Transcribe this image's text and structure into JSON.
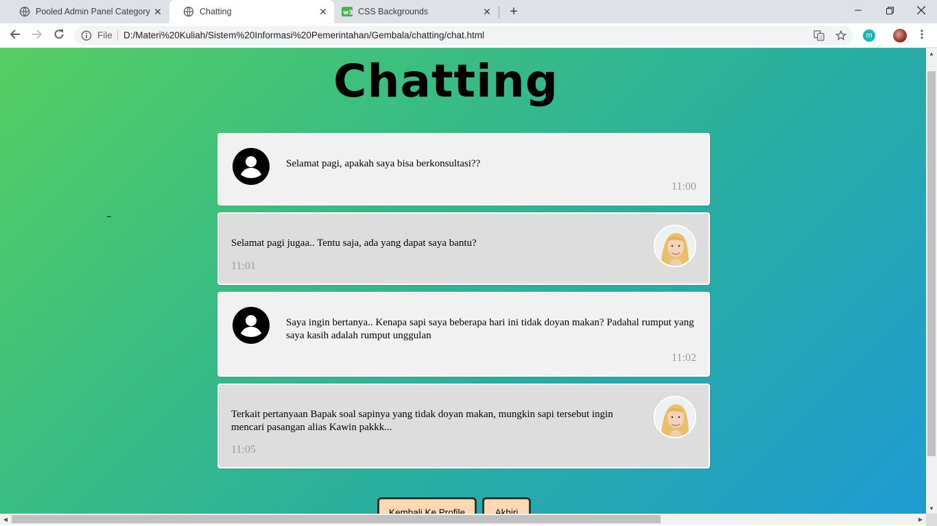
{
  "browser": {
    "tabs": [
      {
        "title": "Pooled Admin Panel Category Fla",
        "icon": "globe-icon",
        "active": false
      },
      {
        "title": "Chatting",
        "icon": "globe-icon",
        "active": true
      },
      {
        "title": "CSS Backgrounds",
        "icon": "w3schools-icon",
        "active": false
      }
    ],
    "omnibox": {
      "scheme_label": "File",
      "url": "D:/Materi%20Kuliah/Sistem%20Informasi%20Pemerintahan/Gembala/chatting/chat.html"
    },
    "extension_letter": "m"
  },
  "page": {
    "title": "Chatting",
    "messages": [
      {
        "sender": "user",
        "text": "Selamat pagi, apakah saya bisa berkonsultasi??",
        "time": "11:00"
      },
      {
        "sender": "reply",
        "text": "Selamat pagi jugaa.. Tentu saja, ada yang dapat saya bantu?",
        "time": "11:01"
      },
      {
        "sender": "user",
        "text": "Saya ingin bertanya.. Kenapa sapi saya beberapa hari ini tidak doyan makan? Padahal rumput yang saya kasih adalah rumput unggulan",
        "time": "11:02"
      },
      {
        "sender": "reply",
        "text": "Terkait pertanyaan Bapak soal sapinya yang tidak doyan makan, mungkin sapi tersebut ingin mencari pasangan alias Kawin pakkk...",
        "time": "11:05"
      }
    ],
    "buttons": {
      "back": "Kembali Ke Profile",
      "end": "Akhiri"
    }
  },
  "colors": {
    "gradient_start": "#55cf62",
    "gradient_end": "#1e9bd4",
    "user_bubble": "#f1f1f1",
    "reply_bubble": "#dddddd",
    "button_bg": "#ffd9b3"
  }
}
